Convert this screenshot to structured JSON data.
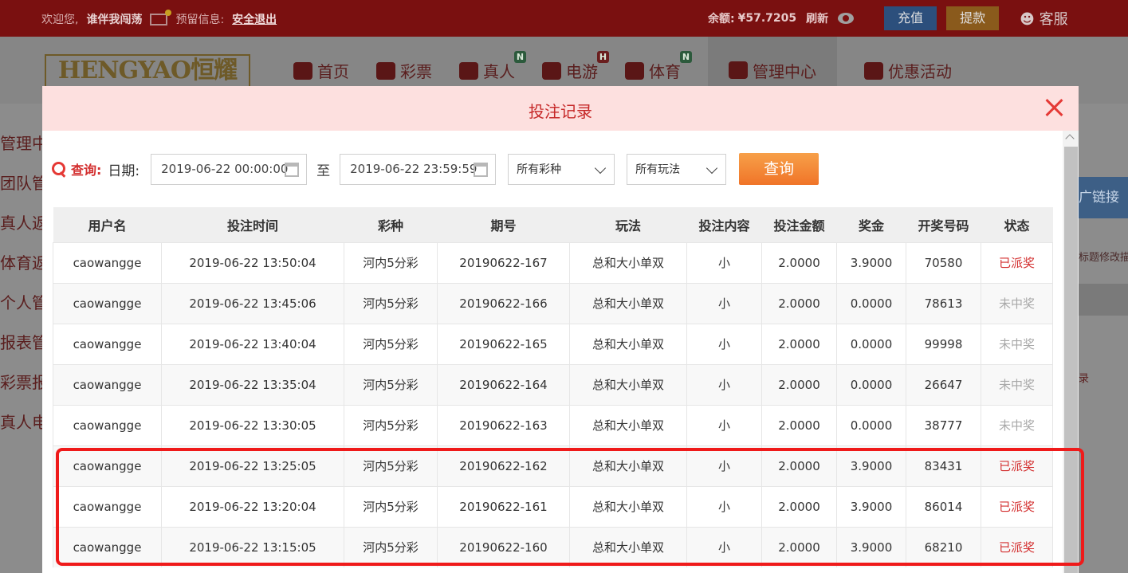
{
  "topbar": {
    "welcome": "欢迎您,",
    "username": "谁伴我闯荡",
    "reserved_label": "预留信息:",
    "logout": "安全退出",
    "balance_label": "余额:",
    "balance_value": "¥57.7205",
    "refresh": "刷新",
    "recharge": "充值",
    "withdraw": "提款",
    "service": "客服"
  },
  "logo_text": "HENGYAO恒耀",
  "nav": [
    {
      "label": "首页",
      "icon": "home-icon"
    },
    {
      "label": "彩票",
      "icon": "lottery-icon"
    },
    {
      "label": "真人",
      "icon": "live-icon",
      "badge": "N"
    },
    {
      "label": "电游",
      "icon": "slot-icon",
      "badge": "H"
    },
    {
      "label": "体育",
      "icon": "trophy-icon",
      "badge": "N"
    },
    {
      "label": "管理中心",
      "icon": "users-icon"
    },
    {
      "label": "优惠活动",
      "icon": "gift-icon"
    }
  ],
  "sidebar": [
    "管理中",
    "团队管",
    "真人返",
    "体育返",
    "个人管",
    "报表管",
    "彩票报",
    "真人电"
  ],
  "right_panel": {
    "promo": "广链接",
    "title_edit": "标题修改描",
    "link": "录"
  },
  "modal": {
    "title": "投注记录",
    "query_label": "查询:",
    "date_label": "日期:",
    "start_date": "2019-06-22 00:00:00",
    "to_label": "至",
    "end_date": "2019-06-22 23:59:59",
    "lottery_select": "所有彩种",
    "play_select": "所有玩法",
    "query_button": "查询"
  },
  "table": {
    "headers": [
      "用户名",
      "投注时间",
      "彩种",
      "期号",
      "玩法",
      "投注内容",
      "投注金额",
      "奖金",
      "开奖号码",
      "状态"
    ],
    "rows": [
      [
        "caowangge",
        "2019-06-22 13:50:04",
        "河内5分彩",
        "20190622-167",
        "总和大小单双",
        "小",
        "2.0000",
        "3.9000",
        "70580",
        "已派奖"
      ],
      [
        "caowangge",
        "2019-06-22 13:45:06",
        "河内5分彩",
        "20190622-166",
        "总和大小单双",
        "小",
        "2.0000",
        "0.0000",
        "78613",
        "未中奖"
      ],
      [
        "caowangge",
        "2019-06-22 13:40:04",
        "河内5分彩",
        "20190622-165",
        "总和大小单双",
        "小",
        "2.0000",
        "0.0000",
        "99998",
        "未中奖"
      ],
      [
        "caowangge",
        "2019-06-22 13:35:04",
        "河内5分彩",
        "20190622-164",
        "总和大小单双",
        "小",
        "2.0000",
        "0.0000",
        "26647",
        "未中奖"
      ],
      [
        "caowangge",
        "2019-06-22 13:30:05",
        "河内5分彩",
        "20190622-163",
        "总和大小单双",
        "小",
        "2.0000",
        "0.0000",
        "38777",
        "未中奖"
      ],
      [
        "caowangge",
        "2019-06-22 13:25:05",
        "河内5分彩",
        "20190622-162",
        "总和大小单双",
        "小",
        "2.0000",
        "3.9000",
        "83431",
        "已派奖"
      ],
      [
        "caowangge",
        "2019-06-22 13:20:04",
        "河内5分彩",
        "20190622-161",
        "总和大小单双",
        "小",
        "2.0000",
        "3.9000",
        "86014",
        "已派奖"
      ],
      [
        "caowangge",
        "2019-06-22 13:15:05",
        "河内5分彩",
        "20190622-160",
        "总和大小单双",
        "小",
        "2.0000",
        "3.9000",
        "68210",
        "已派奖"
      ]
    ]
  },
  "colors": {
    "accent": "#c62828",
    "win": "#d32f2f",
    "lose": "#a8a8a8",
    "highlight": "#ef1a1a",
    "query_button": "#f07428"
  }
}
